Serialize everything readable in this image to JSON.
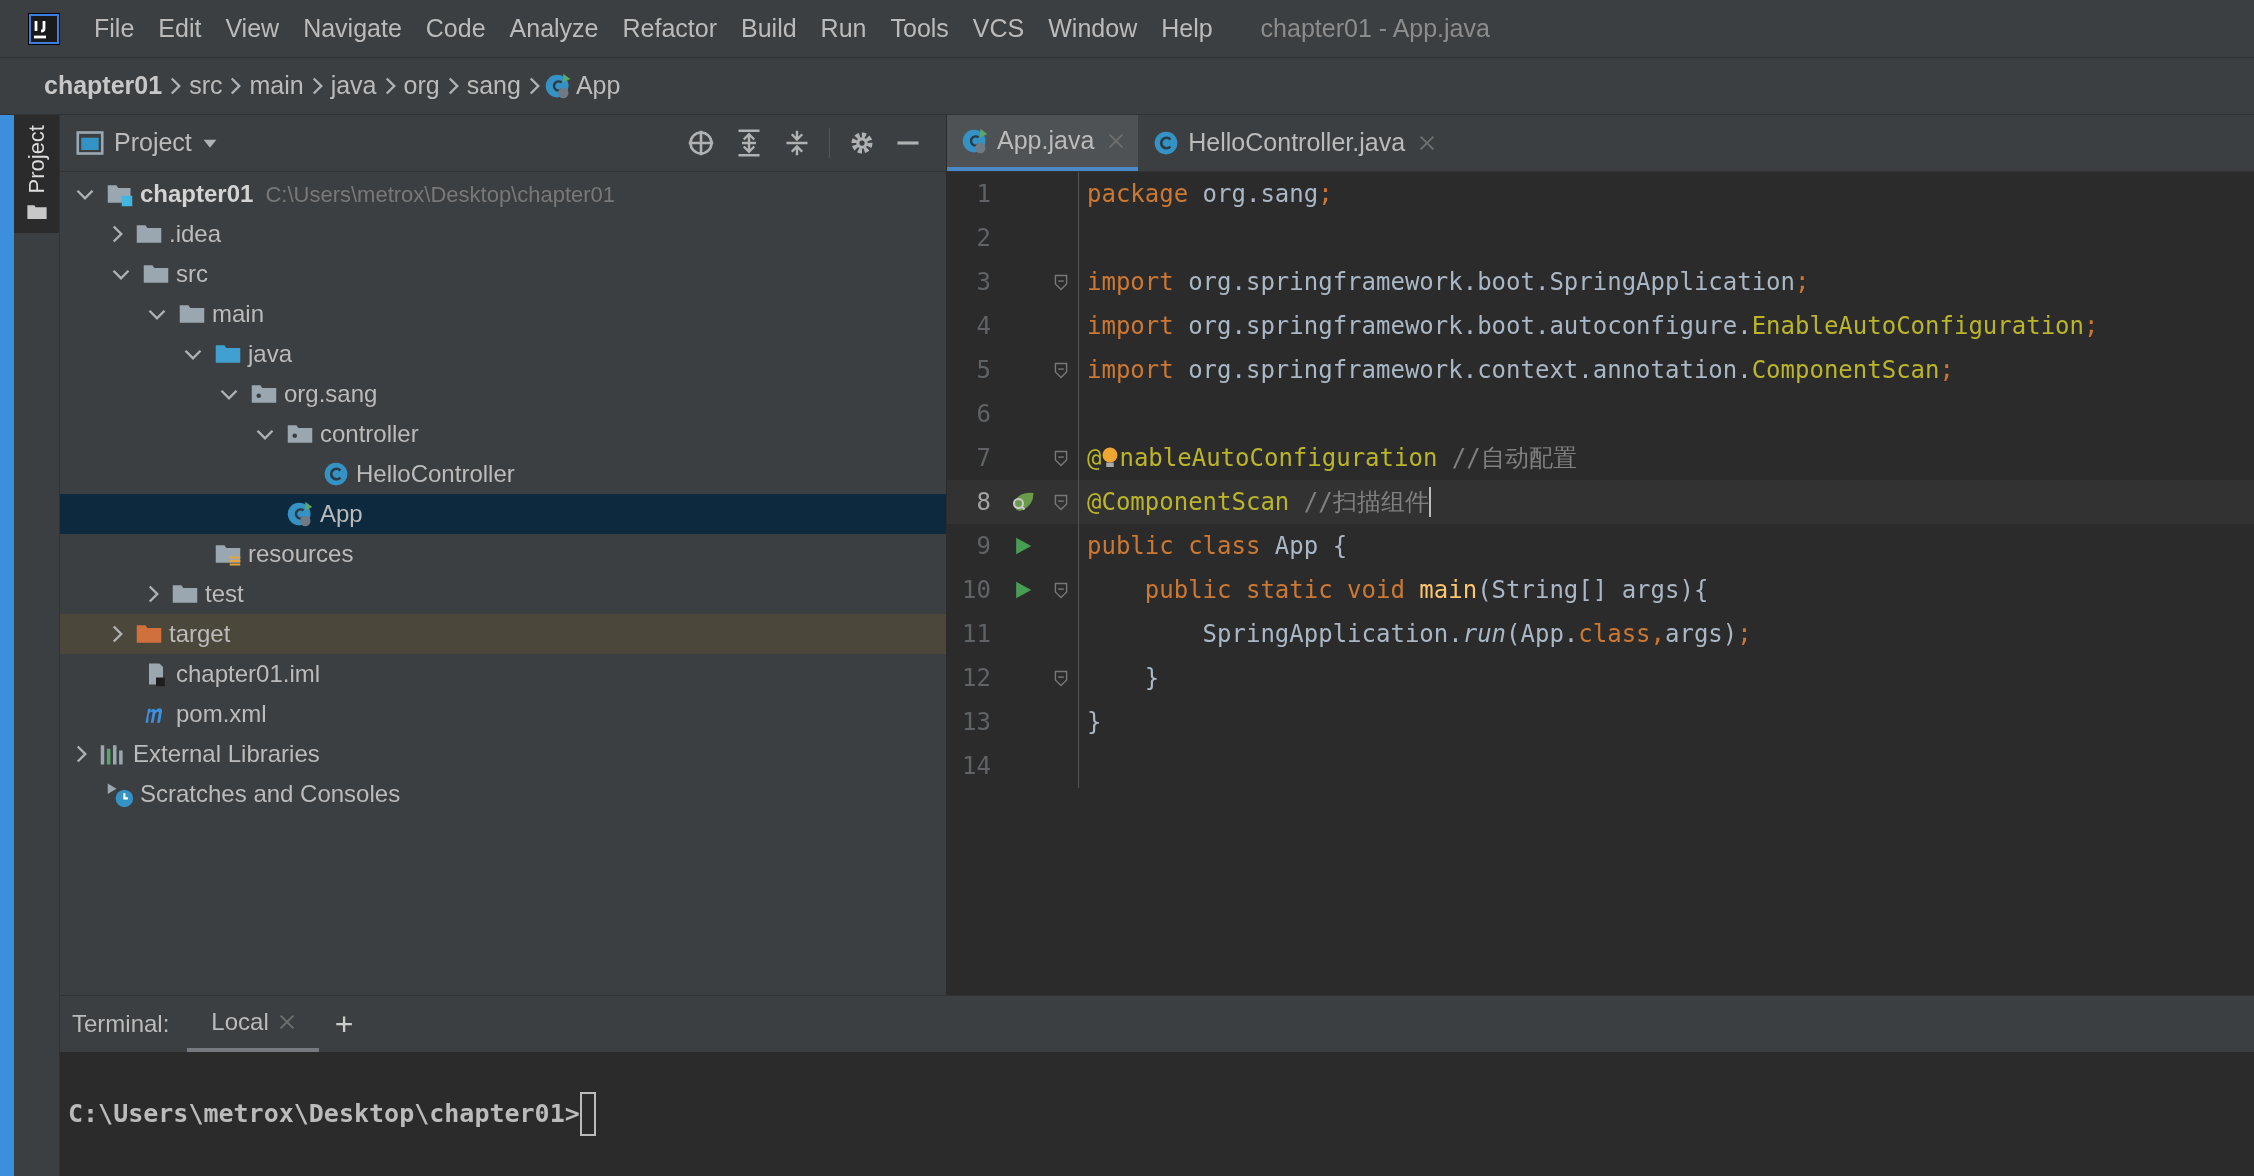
{
  "menu_bar": {
    "items": [
      "File",
      "Edit",
      "View",
      "Navigate",
      "Code",
      "Analyze",
      "Refactor",
      "Build",
      "Run",
      "Tools",
      "VCS",
      "Window",
      "Help"
    ],
    "title": "chapter01 - App.java"
  },
  "breadcrumbs": [
    {
      "label": "chapter01",
      "kind": "root"
    },
    {
      "label": "src",
      "kind": "folder"
    },
    {
      "label": "main",
      "kind": "folder"
    },
    {
      "label": "java",
      "kind": "folder"
    },
    {
      "label": "org",
      "kind": "folder"
    },
    {
      "label": "sang",
      "kind": "folder"
    },
    {
      "label": "App",
      "kind": "app-class"
    }
  ],
  "tool_stripe": {
    "label": "Project"
  },
  "project_panel": {
    "title": "Project",
    "tree": [
      {
        "label": "chapter01",
        "path": "C:\\Users\\metrox\\Desktop\\chapter01",
        "kind": "module",
        "expanded": true,
        "selected": false,
        "children": [
          {
            "label": ".idea",
            "kind": "folder",
            "expanded": false,
            "selected": false
          },
          {
            "label": "src",
            "kind": "folder",
            "expanded": true,
            "selected": false,
            "children": [
              {
                "label": "main",
                "kind": "folder",
                "expanded": true,
                "selected": false,
                "children": [
                  {
                    "label": "java",
                    "kind": "source-folder",
                    "expanded": true,
                    "selected": false,
                    "children": [
                      {
                        "label": "org.sang",
                        "kind": "package",
                        "expanded": true,
                        "selected": false,
                        "children": [
                          {
                            "label": "controller",
                            "kind": "package",
                            "expanded": true,
                            "selected": false,
                            "children": [
                              {
                                "label": "HelloController",
                                "kind": "class",
                                "selected": false
                              }
                            ]
                          },
                          {
                            "label": "App",
                            "kind": "app-class",
                            "selected": true
                          }
                        ]
                      }
                    ]
                  },
                  {
                    "label": "resources",
                    "kind": "resources",
                    "selected": false
                  }
                ]
              },
              {
                "label": "test",
                "kind": "folder",
                "expanded": false,
                "selected": false
              }
            ]
          },
          {
            "label": "target",
            "kind": "excluded-folder",
            "expanded": false,
            "selected": false
          },
          {
            "label": "chapter01.iml",
            "kind": "iml",
            "selected": false
          },
          {
            "label": "pom.xml",
            "kind": "maven",
            "selected": false
          }
        ]
      },
      {
        "label": "External Libraries",
        "kind": "libraries",
        "expanded": false,
        "selected": false
      },
      {
        "label": "Scratches and Consoles",
        "kind": "scratches",
        "selected": false
      }
    ]
  },
  "editor_tabs": [
    {
      "label": "App.java",
      "kind": "app-class",
      "selected": true
    },
    {
      "label": "HelloController.java",
      "kind": "class",
      "selected": false
    }
  ],
  "code_lines": [
    {
      "number": "1",
      "tokens": [
        {
          "text": "package",
          "kind": "keyword"
        },
        {
          "text": " org.sang",
          "kind": "plain"
        },
        {
          "text": ";",
          "kind": "keyword"
        }
      ]
    },
    {
      "number": "2"
    },
    {
      "number": "3",
      "fold": true,
      "tokens": [
        {
          "text": "import",
          "kind": "keyword"
        },
        {
          "text": " org.springframework.boot.SpringApplication",
          "kind": "plain"
        },
        {
          "text": ";",
          "kind": "keyword"
        }
      ]
    },
    {
      "number": "4",
      "tokens": [
        {
          "text": "import",
          "kind": "keyword"
        },
        {
          "text": " org.springframework.boot.autoconfigure.",
          "kind": "plain"
        },
        {
          "text": "EnableAutoConfiguration",
          "kind": "annotation"
        },
        {
          "text": ";",
          "kind": "keyword"
        }
      ]
    },
    {
      "number": "5",
      "fold": true,
      "tokens": [
        {
          "text": "import",
          "kind": "keyword"
        },
        {
          "text": " org.springframework.context.annotation.",
          "kind": "plain"
        },
        {
          "text": "ComponentScan",
          "kind": "annotation"
        },
        {
          "text": ";",
          "kind": "keyword"
        }
      ]
    },
    {
      "number": "6"
    },
    {
      "number": "7",
      "fold": true,
      "tokens": [
        {
          "text": "@",
          "kind": "annotation"
        },
        {
          "kind": "bulb"
        },
        {
          "text": "nableAutoConfiguration",
          "kind": "annotation"
        },
        {
          "text": " //自动配置",
          "kind": "comment"
        }
      ]
    },
    {
      "number": "8",
      "fold": true,
      "current": true,
      "bean_marker": true,
      "tokens": [
        {
          "text": "@ComponentScan",
          "kind": "annotation"
        },
        {
          "text": " //扫描组件",
          "kind": "comment"
        },
        {
          "kind": "caret"
        }
      ]
    },
    {
      "number": "9",
      "run_marker": true,
      "tokens": [
        {
          "text": "public class ",
          "kind": "keyword"
        },
        {
          "text": "App {",
          "kind": "plain"
        }
      ]
    },
    {
      "number": "10",
      "run_marker": true,
      "fold": true,
      "tokens": [
        {
          "text": "    public static void ",
          "kind": "keyword"
        },
        {
          "text": "main",
          "kind": "function"
        },
        {
          "text": "(String[] args){",
          "kind": "plain"
        }
      ]
    },
    {
      "number": "11",
      "tokens": [
        {
          "text": "        SpringApplication.",
          "kind": "plain"
        },
        {
          "text": "run",
          "kind": "static-call"
        },
        {
          "text": "(App.",
          "kind": "plain"
        },
        {
          "text": "class,",
          "kind": "keyword"
        },
        {
          "text": "args)",
          "kind": "plain"
        },
        {
          "text": ";",
          "kind": "keyword"
        }
      ]
    },
    {
      "number": "12",
      "fold": true,
      "tokens": [
        {
          "text": "    }",
          "kind": "plain"
        }
      ]
    },
    {
      "number": "13",
      "tokens": [
        {
          "text": "}",
          "kind": "plain"
        }
      ]
    },
    {
      "number": "14"
    }
  ],
  "terminal": {
    "label": "Terminal:",
    "tabs": [
      {
        "label": "Local",
        "selected": true
      }
    ],
    "add": "+",
    "prompt": "C:\\Users\\metrox\\Desktop\\chapter01>"
  }
}
